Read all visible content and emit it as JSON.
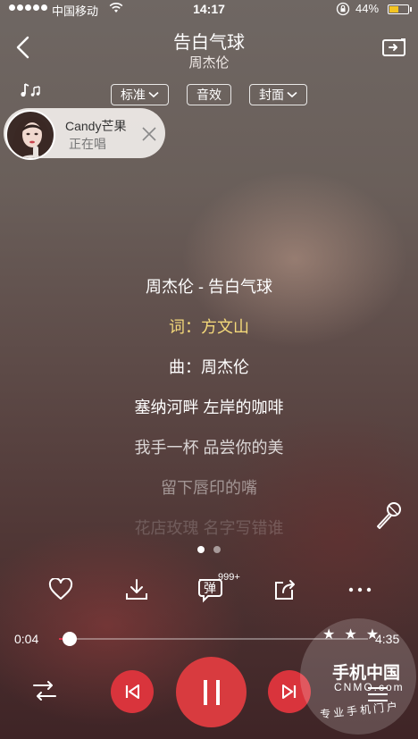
{
  "status_bar": {
    "carrier": "中国移动",
    "time": "14:17",
    "battery_percent": "44%",
    "battery_level": 0.44,
    "battery_color": "#f3c422"
  },
  "header": {
    "song_title": "告白气球",
    "artist": "周杰伦",
    "back_icon": "chevron-left-icon",
    "cast_icon": "cast-screen-icon"
  },
  "options": {
    "quality_label": "标准",
    "effects_label": "音效",
    "cover_label": "封面"
  },
  "singer_chip": {
    "name": "Candy芒果",
    "status": "正在唱"
  },
  "lyrics": [
    "周杰伦 - 告白气球",
    "词：方文山",
    "曲：周杰伦",
    "塞纳河畔 左岸的咖啡",
    "我手一杯 品尝你的美",
    "留下唇印的嘴",
    "花店玫瑰 名字写错谁"
  ],
  "lyrics_highlight_color": "#f4d97a",
  "page_indicator": {
    "pages": 2,
    "current": 1
  },
  "actions": {
    "danmu_label": "弹",
    "danmu_count": "999+"
  },
  "progress": {
    "current": "0:04",
    "total": "4:35",
    "accent_color": "#e0334a"
  },
  "transport": {
    "play_color": "#d83b3f"
  },
  "watermark": {
    "brand": "手机中国",
    "sub": "CNMO.com",
    "slogan": "专业手机门户"
  }
}
